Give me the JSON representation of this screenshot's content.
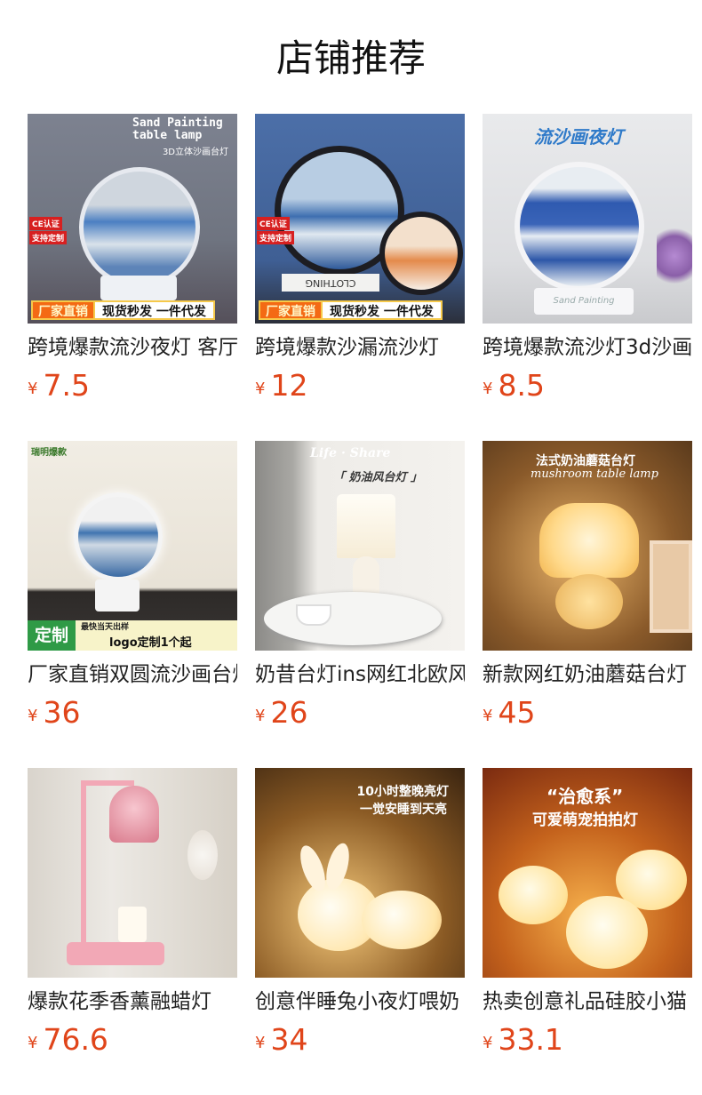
{
  "header": {
    "title": "店铺推荐"
  },
  "products": [
    {
      "name": "跨境爆款流沙夜灯 客厅",
      "price": "7.5",
      "image": {
        "heading": "Sand Painting table lamp",
        "sub": "3D立体沙画台灯",
        "tag1": "CE认证",
        "tag2": "支持定制",
        "badge_left": "厂家直销",
        "badge_right": "现货秒发 一件代发"
      }
    },
    {
      "name": "跨境爆款沙漏流沙灯",
      "price": "12",
      "image": {
        "tag1": "CE认证",
        "tag2": "支持定制",
        "book": "CLOTHING",
        "badge_left": "厂家直销",
        "badge_right": "现货秒发 一件代发"
      }
    },
    {
      "name": "跨境爆款流沙灯3d沙画",
      "price": "8.5",
      "image": {
        "heading": "流沙画夜灯",
        "base": "Sand Painting"
      }
    },
    {
      "name": "厂家直销双圆流沙画台灯",
      "price": "36",
      "image": {
        "corner": "瑞明爆款",
        "badge_left": "定制",
        "badge_top": "最快当天出样",
        "badge_right": "logo定制1个起"
      }
    },
    {
      "name": "奶昔台灯ins网红北欧风",
      "price": "26",
      "image": {
        "heading": "Life · Share",
        "sub": "「 奶油风台灯 」"
      }
    },
    {
      "name": "新款网红奶油蘑菇台灯",
      "price": "45",
      "image": {
        "heading": "法式奶油蘑菇台灯",
        "sub": "mushroom table lamp"
      }
    },
    {
      "name": "爆款花季香薰融蜡灯",
      "price": "76.6",
      "image": {}
    },
    {
      "name": "创意伴睡兔小夜灯喂奶",
      "price": "34",
      "image": {
        "heading": "10小时整晚亮灯",
        "sub": "一觉安睡到天亮"
      }
    },
    {
      "name": "热卖创意礼品硅胶小猫",
      "price": "33.1",
      "image": {
        "heading": "“治愈系”",
        "sub": "可爱萌宠拍拍灯"
      }
    }
  ],
  "colors": {
    "price": "#e0451a",
    "text": "#222222"
  },
  "currency": "¥"
}
